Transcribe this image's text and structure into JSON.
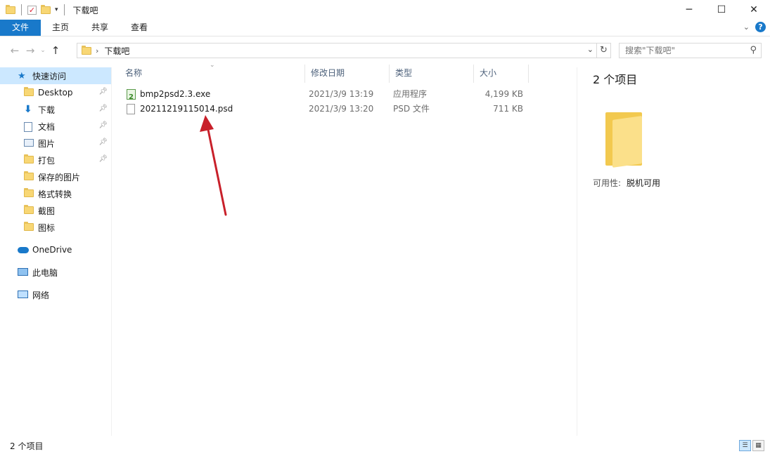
{
  "window": {
    "title": "下载吧",
    "minimize_glyph": "─",
    "maximize_glyph": "☐",
    "close_glyph": "✕"
  },
  "ribbon": {
    "tabs": [
      {
        "label": "文件"
      },
      {
        "label": "主页"
      },
      {
        "label": "共享"
      },
      {
        "label": "查看"
      }
    ],
    "help_glyph": "?"
  },
  "address": {
    "crumb": "下载吧",
    "search_placeholder": "搜索\"下载吧\""
  },
  "nav": {
    "quick_access": "快速访问",
    "items": [
      {
        "label": "Desktop",
        "icon": "folder-icon",
        "pinned": true
      },
      {
        "label": "下载",
        "icon": "download-arrow-icon",
        "pinned": true
      },
      {
        "label": "文档",
        "icon": "document-icon",
        "pinned": true
      },
      {
        "label": "图片",
        "icon": "picture-icon",
        "pinned": true
      },
      {
        "label": "打包",
        "icon": "folder-icon",
        "pinned": true
      },
      {
        "label": "保存的图片",
        "icon": "folder-icon",
        "pinned": false
      },
      {
        "label": "格式转换",
        "icon": "folder-icon",
        "pinned": false
      },
      {
        "label": "截图",
        "icon": "folder-icon",
        "pinned": false
      },
      {
        "label": "图标",
        "icon": "folder-icon",
        "pinned": false
      }
    ],
    "onedrive": "OneDrive",
    "this_pc": "此电脑",
    "network": "网络"
  },
  "columns": {
    "name": "名称",
    "date": "修改日期",
    "type": "类型",
    "size": "大小"
  },
  "files": [
    {
      "name": "bmp2psd2.3.exe",
      "date": "2021/3/9 13:19",
      "type": "应用程序",
      "size": "4,199 KB",
      "icon": "exe-icon"
    },
    {
      "name": "20211219115014.psd",
      "date": "2021/3/9 13:20",
      "type": "PSD 文件",
      "size": "711 KB",
      "icon": "psd-file-icon"
    }
  ],
  "details": {
    "count": "2 个项目",
    "availability_label": "可用性:",
    "availability_value": "脱机可用"
  },
  "status": {
    "item_count": "2 个项目"
  },
  "colors": {
    "accent": "#1979ca",
    "selection": "#cce8ff",
    "annotation_arrow": "#c8202a"
  }
}
